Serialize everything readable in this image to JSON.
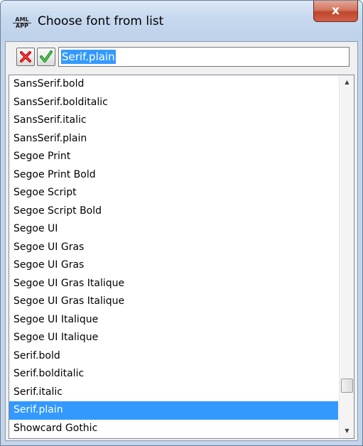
{
  "window": {
    "title": "Choose font from list",
    "icon": "aml-app-icon",
    "icon_text_top": "AML",
    "icon_text_bottom": "APP",
    "close_label": "x"
  },
  "toolbar": {
    "cancel_icon": "red-x-icon",
    "ok_icon": "green-check-icon",
    "input_value": "Serif.plain"
  },
  "font_list": {
    "items": [
      "SansSerif.bold",
      "SansSerif.bolditalic",
      "SansSerif.italic",
      "SansSerif.plain",
      "Segoe Print",
      "Segoe Print Bold",
      "Segoe Script",
      "Segoe Script Bold",
      "Segoe UI",
      "Segoe UI Gras",
      "Segoe UI Gras",
      "Segoe UI Gras Italique",
      "Segoe UI Gras Italique",
      "Segoe UI Italique",
      "Segoe UI Italique",
      "Serif.bold",
      "Serif.bolditalic",
      "Serif.italic",
      "Serif.plain",
      "Showcard Gothic"
    ],
    "selected_index": 18
  },
  "colors": {
    "selection": "#3399ff",
    "titlebar": "#c4d5ea",
    "close_button": "#c0462a"
  }
}
